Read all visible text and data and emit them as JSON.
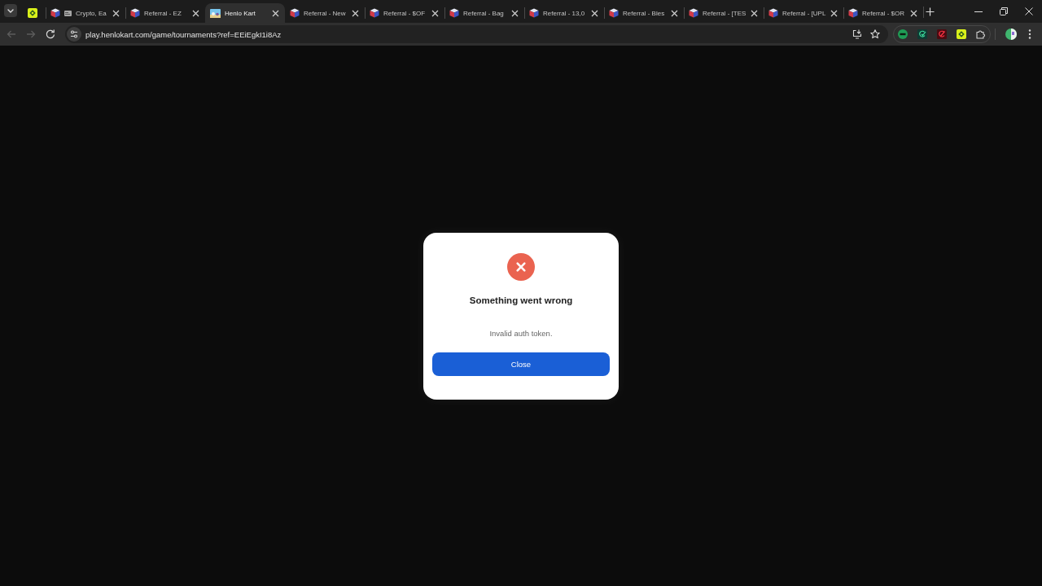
{
  "browser": {
    "tabs": [
      {
        "kind": "pinned",
        "selected": false
      },
      {
        "kind": "card",
        "title": "Crypto, Ea",
        "selected": false
      },
      {
        "kind": "cube",
        "title": "Referral - EZ",
        "selected": false
      },
      {
        "kind": "game",
        "title": "Henlo Kart",
        "selected": true
      },
      {
        "kind": "cube",
        "title": "Referral - New",
        "selected": false
      },
      {
        "kind": "cube",
        "title": "Referral - $OF",
        "selected": false
      },
      {
        "kind": "cube",
        "title": "Referral - Bag",
        "selected": false
      },
      {
        "kind": "cube",
        "title": "Referral - 13,0",
        "selected": false
      },
      {
        "kind": "cube",
        "title": "Referral - Bles",
        "selected": false
      },
      {
        "kind": "cube",
        "title": "Referral - [TES",
        "selected": false
      },
      {
        "kind": "cube",
        "title": "Referral - [UPL",
        "selected": false
      },
      {
        "kind": "cube",
        "title": "Referral - $OR",
        "selected": false
      }
    ],
    "navigation": {
      "back": {
        "disabled": true
      },
      "forward": {
        "disabled": true
      }
    },
    "address_bar": {
      "url": "play.henlokart.com/game/tournaments?ref=EEiEgkI1i8Az"
    }
  },
  "dialog": {
    "title": "Something went wrong",
    "message": "Invalid auth token.",
    "button": "Close"
  }
}
